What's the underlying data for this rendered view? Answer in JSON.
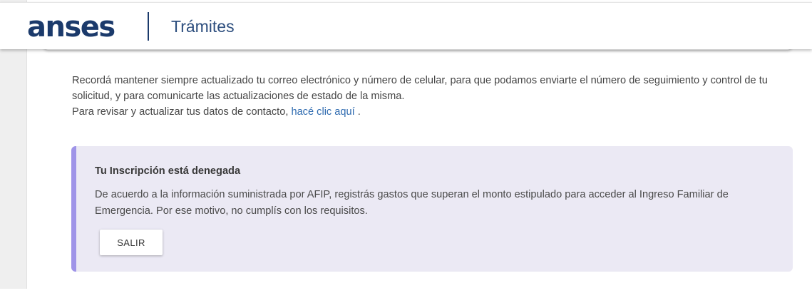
{
  "header": {
    "logo_text": "anses",
    "section_title": "Trámites"
  },
  "info": {
    "line1": "Recordá mantener siempre actualizado tu correo electrónico y número de celular, para que podamos enviarte el número de seguimiento y control de tu solicitud, y para comunicarte las actualizaciones de estado de la misma.",
    "line2_prefix": "Para revisar y actualizar tus datos de contacto,",
    "link_text": "hacé clic aquí",
    "line2_suffix": "."
  },
  "alert": {
    "title": "Tu Inscripción está denegada",
    "body": "De acuerdo a la información suministrada por AFIP, registrás gastos que superan el monto estipulado para acceder al Ingreso Familiar de Emergencia. Por ese motivo, no cumplís con los requisitos.",
    "button_label": "SALIR"
  },
  "colors": {
    "brand": "#1b3a6b",
    "link": "#2f6bb0",
    "alert_background": "#ebe9f4",
    "alert_accent": "#9f94e8"
  }
}
